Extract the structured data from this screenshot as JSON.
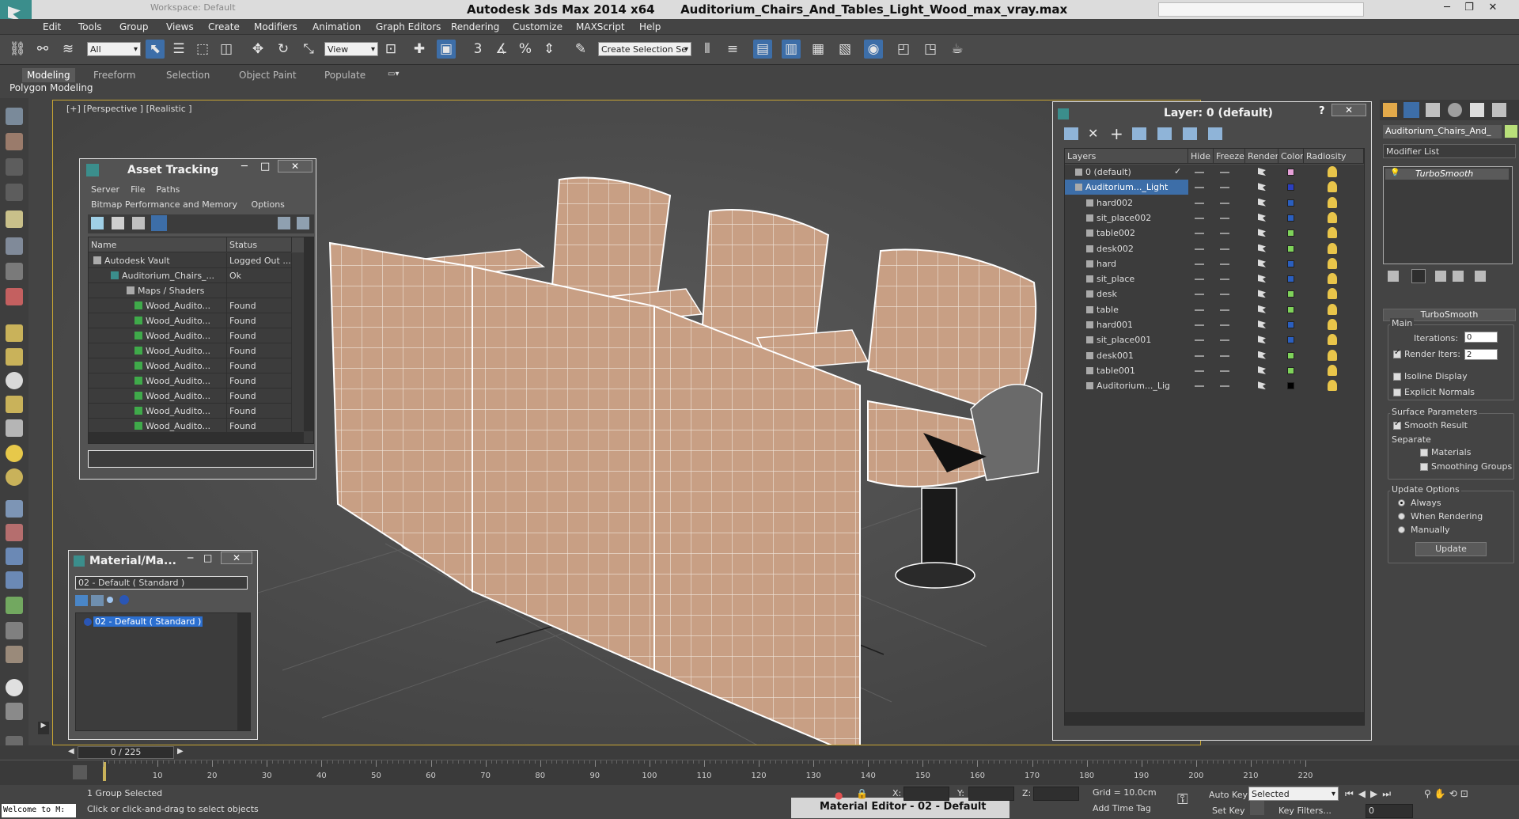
{
  "title_bar": {
    "workspace": "Workspace: Default",
    "app_title": "Autodesk 3ds Max  2014 x64",
    "file_title": "Auditorium_Chairs_And_Tables_Light_Wood_max_vray.max",
    "minimize": "─",
    "restore": "❐",
    "close": "✕"
  },
  "menu": [
    "Edit",
    "Tools",
    "Group",
    "Views",
    "Create",
    "Modifiers",
    "Animation",
    "Graph Editors",
    "Rendering",
    "Customize",
    "MAXScript",
    "Help"
  ],
  "toolbar": {
    "selection_filter": "All",
    "ref_coord": "View",
    "named_selection": "Create Selection Se",
    "snap_3": "3",
    "snap_pct": "%"
  },
  "ribbon": {
    "tabs": [
      "Modeling",
      "Freeform",
      "Selection",
      "Object Paint",
      "Populate"
    ],
    "active_tab": "Modeling",
    "sub_label": "Polygon Modeling"
  },
  "viewport": {
    "label": "[+] [Perspective ] [Realistic ]"
  },
  "asset_tracking": {
    "title": "Asset Tracking",
    "menu_row1": [
      "Server",
      "File",
      "Paths"
    ],
    "menu_row2": [
      "Bitmap Performance and Memory",
      "Options"
    ],
    "columns": [
      "Name",
      "Status"
    ],
    "rows": [
      {
        "name": "Autodesk Vault",
        "status": "Logged Out ..."
      },
      {
        "name": "Auditorium_Chairs_...",
        "status": "Ok"
      },
      {
        "name": "Maps / Shaders",
        "status": ""
      },
      {
        "name": "Wood_Audito...",
        "status": "Found"
      },
      {
        "name": "Wood_Audito...",
        "status": "Found"
      },
      {
        "name": "Wood_Audito...",
        "status": "Found"
      },
      {
        "name": "Wood_Audito...",
        "status": "Found"
      },
      {
        "name": "Wood_Audito...",
        "status": "Found"
      },
      {
        "name": "Wood_Audito...",
        "status": "Found"
      },
      {
        "name": "Wood_Audito...",
        "status": "Found"
      },
      {
        "name": "Wood_Audito...",
        "status": "Found"
      },
      {
        "name": "Wood_Audito...",
        "status": "Found"
      }
    ]
  },
  "material_browser": {
    "title": "Material/Ma...",
    "current": "02 - Default  ( Standard )",
    "items": [
      "02 - Default  ( Standard )"
    ]
  },
  "layer_manager": {
    "title": "Layer: 0 (default)",
    "help": "?",
    "columns": [
      "Layers",
      "Hide",
      "Freeze",
      "Render",
      "Color",
      "Radiosity"
    ],
    "layers": [
      {
        "name": "0 (default)",
        "color": "#e6a0d8",
        "level": 0,
        "current": true
      },
      {
        "name": "Auditorium..._Light",
        "color": "#2b3fbf",
        "level": 0,
        "selected": true
      },
      {
        "name": "hard002",
        "color": "#2b5fbf",
        "level": 1
      },
      {
        "name": "sit_place002",
        "color": "#2b5fbf",
        "level": 1
      },
      {
        "name": "table002",
        "color": "#7fd35a",
        "level": 1
      },
      {
        "name": "desk002",
        "color": "#7fd35a",
        "level": 1
      },
      {
        "name": "hard",
        "color": "#2b5fbf",
        "level": 1
      },
      {
        "name": "sit_place",
        "color": "#2b5fbf",
        "level": 1
      },
      {
        "name": "desk",
        "color": "#7fd35a",
        "level": 1
      },
      {
        "name": "table",
        "color": "#7fd35a",
        "level": 1
      },
      {
        "name": "hard001",
        "color": "#2b5fbf",
        "level": 1
      },
      {
        "name": "sit_place001",
        "color": "#2b5fbf",
        "level": 1
      },
      {
        "name": "desk001",
        "color": "#7fd35a",
        "level": 1
      },
      {
        "name": "table001",
        "color": "#7fd35a",
        "level": 1
      },
      {
        "name": "Auditorium..._Lig",
        "color": "#000000",
        "level": 1
      }
    ]
  },
  "command_panel": {
    "object_name": "Auditorium_Chairs_And_",
    "modifier_list": "Modifier List",
    "stack": [
      "TurboSmooth"
    ],
    "turbosmooth": {
      "title": "TurboSmooth",
      "main": "Main",
      "iterations_label": "Iterations:",
      "iterations": "0",
      "render_iters_label": "Render Iters:",
      "render_iters": "2",
      "isoline": "Isoline Display",
      "explicit": "Explicit Normals",
      "surface": "Surface Parameters",
      "smooth_result": "Smooth Result",
      "separate": "Separate",
      "materials": "Materials",
      "smoothing_groups": "Smoothing Groups",
      "update_options": "Update Options",
      "always": "Always",
      "when_rendering": "When Rendering",
      "manually": "Manually",
      "update_button": "Update"
    }
  },
  "timeline": {
    "frame": "0 / 225",
    "ticks": [
      "0",
      "10",
      "20",
      "30",
      "40",
      "50",
      "60",
      "70",
      "80",
      "90",
      "100",
      "110",
      "120",
      "130",
      "140",
      "150",
      "160",
      "170",
      "180",
      "190",
      "200",
      "210",
      "220"
    ]
  },
  "status": {
    "maxscript": "Welcome to M:",
    "selected": "1 Group Selected",
    "prompt": "Click or click-and-drag to select objects",
    "x_label": "X:",
    "y_label": "Y:",
    "z_label": "Z:",
    "grid": "Grid = 10.0cm",
    "add_time_tag": "Add Time Tag",
    "auto_key": "Auto Key",
    "set_key": "Set Key",
    "key_mode": "Selected",
    "key_filters": "Key Filters...",
    "frame_field": "0",
    "material_editor": "Material Editor - 02 - Default"
  }
}
